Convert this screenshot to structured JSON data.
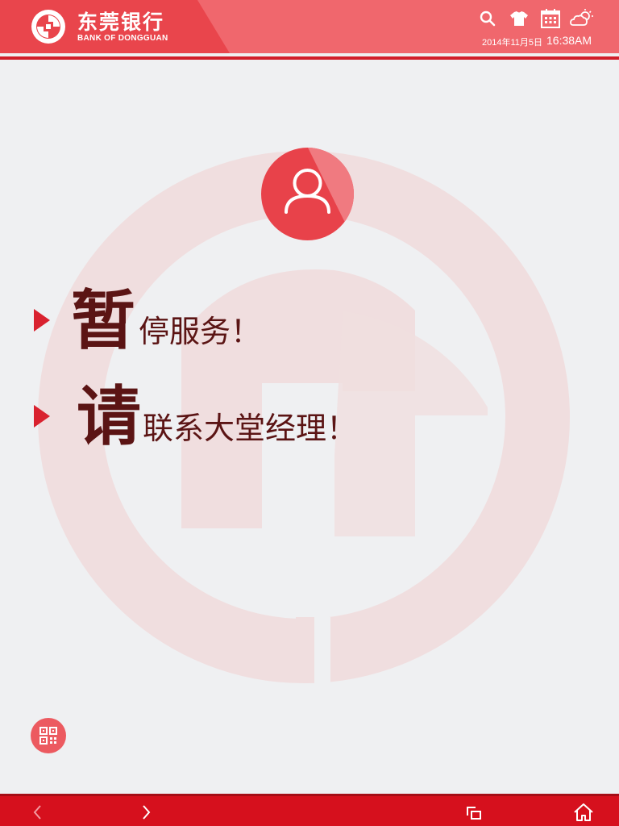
{
  "header": {
    "bank_name_cn": "东莞银行",
    "bank_name_en": "BANK OF DONGGUAN",
    "date": "2014年11月5日",
    "time": "16:38AM",
    "icons": [
      "search-icon",
      "shirt-icon",
      "calendar-icon",
      "weather-icon"
    ]
  },
  "main": {
    "avatar_icon": "user-icon",
    "line1": {
      "big": "暂",
      "rest": "停服务！"
    },
    "line2": {
      "big": "请",
      "rest": "联系大堂经理！"
    }
  },
  "qr_button_icon": "qr-code-icon",
  "footer": {
    "icons": [
      "back-arrow-icon",
      "forward-arrow-icon",
      "window-switch-icon",
      "home-icon"
    ]
  },
  "colors": {
    "header": "#f0676d",
    "header_dark": "#e9454c",
    "accent_red": "#d11e2a",
    "footer": "#d6101d",
    "text_dark_red": "#5b1414",
    "background": "#eff0f2"
  }
}
